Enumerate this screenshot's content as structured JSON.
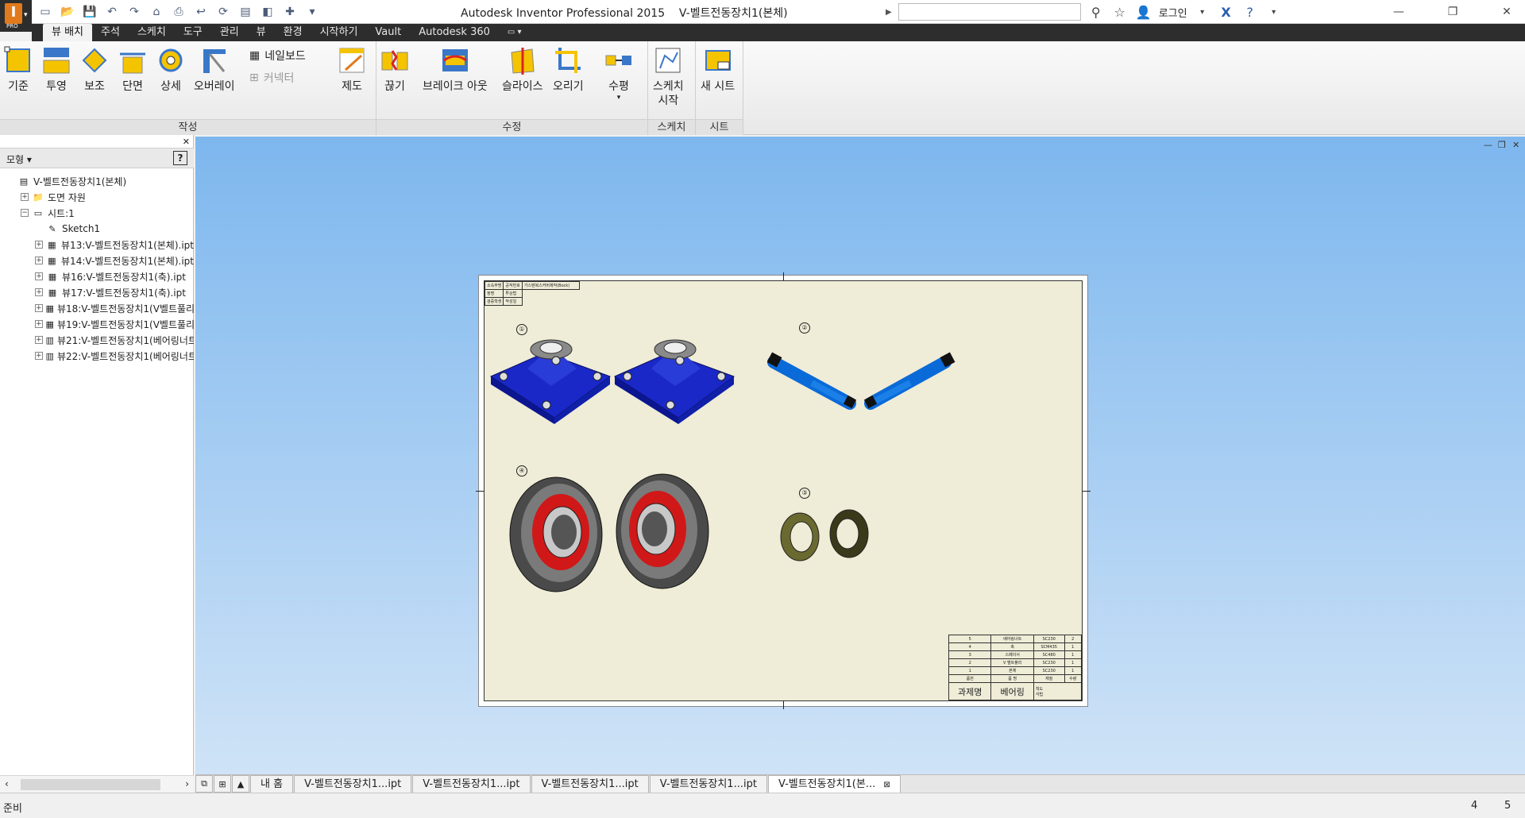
{
  "app": {
    "title": "Autodesk Inventor Professional 2015",
    "document_title": "V-벨트전동장치1(본체)",
    "logo_letter": "I",
    "edition": "PRO"
  },
  "header": {
    "search_placeholder": "",
    "login_label": "로그인"
  },
  "ribbon": {
    "tabs": [
      "뷰 배치",
      "주석",
      "스케치",
      "도구",
      "관리",
      "뷰",
      "환경",
      "시작하기",
      "Vault",
      "Autodesk 360"
    ],
    "active_tab": "뷰 배치",
    "panels": {
      "create": {
        "label": "작성",
        "buttons": [
          "기준",
          "투영",
          "보조",
          "단면",
          "상세",
          "오버레이"
        ],
        "small_buttons": [
          "네일보드",
          "커넥터"
        ],
        "drafting": "제도"
      },
      "modify": {
        "label": "수정",
        "buttons": [
          "끊기",
          "브레이크 아웃",
          "슬라이스",
          "오리기",
          "수평"
        ]
      },
      "sketch": {
        "label": "스케치",
        "button_line1": "스케치",
        "button_line2": "시작"
      },
      "sheets": {
        "label": "시트",
        "button": "새 시트"
      }
    },
    "colors": {
      "tab_bar": "#2d2d2d",
      "icon_yellow": "#f5c400",
      "icon_blue": "#3a77c9"
    }
  },
  "browser": {
    "title": "모형",
    "tree": [
      {
        "label": "V-벨트전동장치1(본체)",
        "icon": "drawing-icon",
        "level": 0,
        "exp": ""
      },
      {
        "label": "도면 자원",
        "icon": "folder-icon",
        "level": 1,
        "exp": "+"
      },
      {
        "label": "시트:1",
        "icon": "sheet-icon",
        "level": 1,
        "exp": "−"
      },
      {
        "label": "Sketch1",
        "icon": "sketch-icon",
        "level": 2,
        "exp": ""
      },
      {
        "label": "뷰13:V-벨트전동장치1(본체).ipt",
        "icon": "view-icon",
        "level": 2,
        "exp": "+"
      },
      {
        "label": "뷰14:V-벨트전동장치1(본체).ipt",
        "icon": "view-icon",
        "level": 2,
        "exp": "+"
      },
      {
        "label": "뷰16:V-벨트전동장치1(축).ipt",
        "icon": "view-icon",
        "level": 2,
        "exp": "+"
      },
      {
        "label": "뷰17:V-벨트전동장치1(축).ipt",
        "icon": "view-icon",
        "level": 2,
        "exp": "+"
      },
      {
        "label": "뷰18:V-벨트전동장치1(V벨트풀리)",
        "icon": "view-icon",
        "level": 2,
        "exp": "+"
      },
      {
        "label": "뷰19:V-벨트전동장치1(V벨트풀리)",
        "icon": "view-icon",
        "level": 2,
        "exp": "+"
      },
      {
        "label": "뷰21:V-벨트전동장치1(베어링너트",
        "icon": "view-table-icon",
        "level": 2,
        "exp": "+"
      },
      {
        "label": "뷰22:V-벨트전동장치1(베어링너트",
        "icon": "view-table-icon",
        "level": 2,
        "exp": "+"
      }
    ]
  },
  "drawing": {
    "balloons": [
      "①",
      "②",
      "③",
      "④"
    ],
    "rev_table": [
      [
        "소속부명",
        "공작번호",
        "가스텐복스커버제작(Bock)"
      ],
      [
        "정명",
        "투상법",
        ""
      ],
      [
        "검증학생",
        "작성일",
        ""
      ]
    ],
    "bom": [
      [
        "5",
        "베어링너트",
        "SC230",
        "2"
      ],
      [
        "4",
        "축",
        "SCM435",
        "1"
      ],
      [
        "3",
        "스페이서",
        "SC480",
        "1"
      ],
      [
        "2",
        "V 벨트풀리",
        "SC230",
        "1"
      ],
      [
        "1",
        "본체",
        "SC230",
        "1"
      ],
      [
        "품번",
        "품 명",
        "재질",
        "수량"
      ]
    ],
    "title_block": {
      "label1": "과제명",
      "label2": "베어링",
      "cell_a": "척도",
      "cell_b": "각법"
    }
  },
  "doc_tabs": [
    "내 홈",
    "V-벨트전동장치1...ipt",
    "V-벨트전동장치1...ipt",
    "V-벨트전동장치1...ipt",
    "V-벨트전동장치1...ipt",
    "V-벨트전동장치1(본..."
  ],
  "status": {
    "text": "준비",
    "count1": "4",
    "count2": "5"
  }
}
